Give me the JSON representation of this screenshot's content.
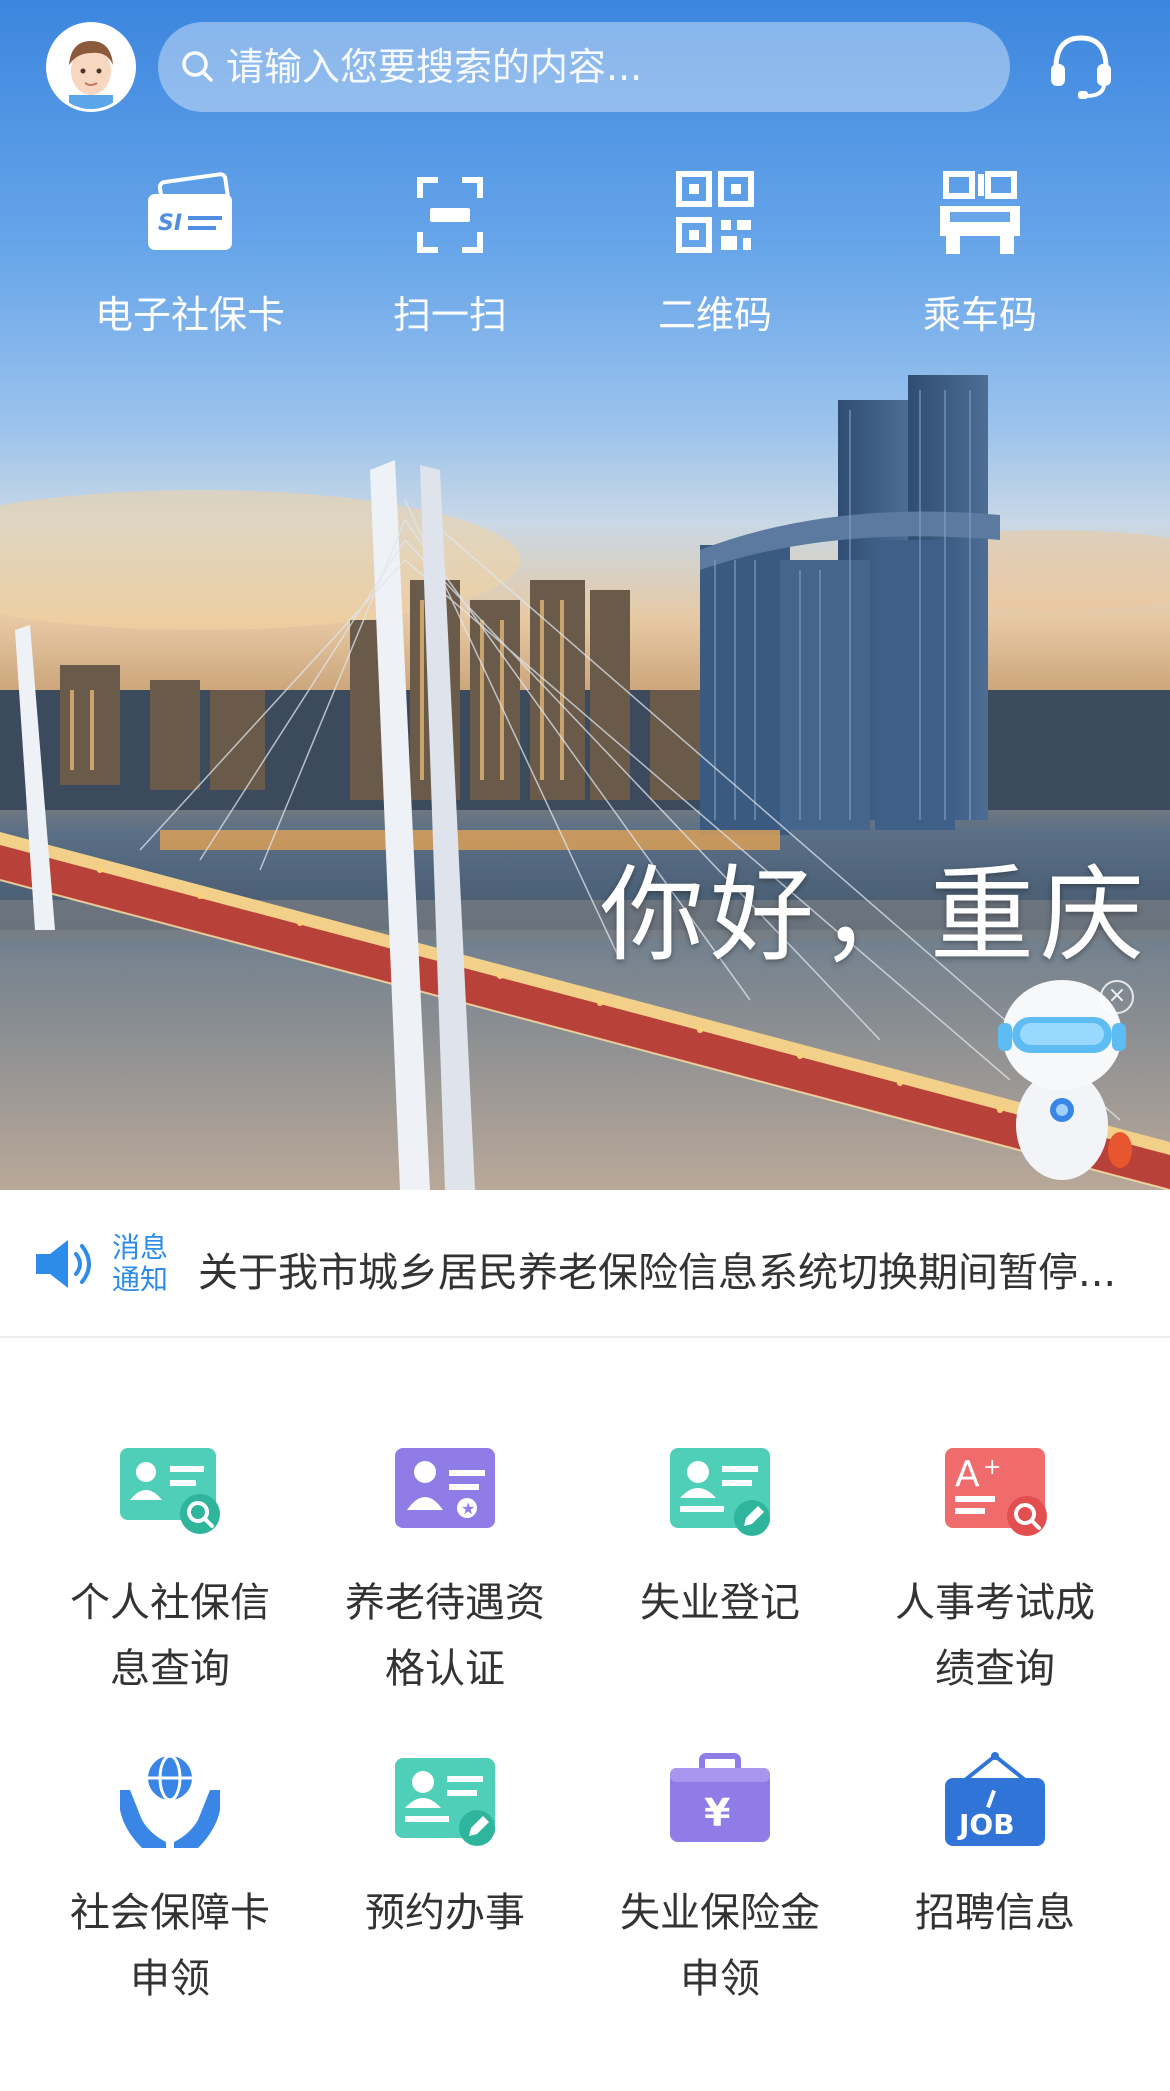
{
  "header": {
    "search_placeholder": "请输入您要搜索的内容..."
  },
  "quick_actions": [
    {
      "label": "电子社保卡",
      "icon": "social-security-card-icon"
    },
    {
      "label": "扫一扫",
      "icon": "scan-icon"
    },
    {
      "label": "二维码",
      "icon": "qr-code-icon"
    },
    {
      "label": "乘车码",
      "icon": "bus-code-icon"
    }
  ],
  "banner": {
    "greeting": "你好，重庆"
  },
  "notice": {
    "tag_line1": "消息",
    "tag_line2": "通知",
    "text": "关于我市城乡居民养老保险信息系统切换期间暂停..."
  },
  "services": [
    {
      "line1": "个人社保信",
      "line2": "息查询",
      "icon": "id-card-search-icon"
    },
    {
      "line1": "养老待遇资",
      "line2": "格认证",
      "icon": "pension-certificate-icon"
    },
    {
      "line1": "失业登记",
      "line2": "",
      "icon": "registration-card-icon"
    },
    {
      "line1": "人事考试成",
      "line2": "绩查询",
      "icon": "exam-score-icon"
    },
    {
      "line1": "社会保障卡",
      "line2": "申领",
      "icon": "hands-globe-icon"
    },
    {
      "line1": "预约办事",
      "line2": "",
      "icon": "appointment-card-icon"
    },
    {
      "line1": "失业保险金",
      "line2": "申领",
      "icon": "briefcase-yuan-icon"
    },
    {
      "line1": "招聘信息",
      "line2": "",
      "icon": "job-sign-icon"
    }
  ],
  "colors": {
    "notice_blue": "#2d8ce8",
    "teal": "#4fcfb7",
    "purple": "#8f7ce6",
    "red": "#f06b6b",
    "blue": "#3a86e6"
  }
}
